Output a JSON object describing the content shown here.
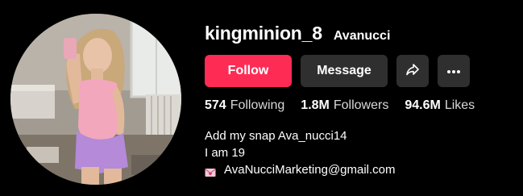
{
  "profile": {
    "username": "kingminion_8",
    "nickname": "Avanucci"
  },
  "actions": {
    "follow_label": "Follow",
    "message_label": "Message",
    "share_icon": "share-arrow-icon",
    "more_icon": "more-horizontal-icon"
  },
  "stats": {
    "following_count": "574",
    "following_label": "Following",
    "followers_count": "1.8M",
    "followers_label": "Followers",
    "likes_count": "94.6M",
    "likes_label": "Likes"
  },
  "bio": {
    "line1": "Add my snap Ava_nucci14",
    "line2": "I am 19",
    "line3": "AvaNucciMarketing@gmail.com",
    "line3_icon": "love-letter-icon"
  },
  "colors": {
    "background": "#000000",
    "follow_button": "#fe2c55",
    "secondary_button": "#2f2f2f",
    "text": "#ffffff"
  }
}
